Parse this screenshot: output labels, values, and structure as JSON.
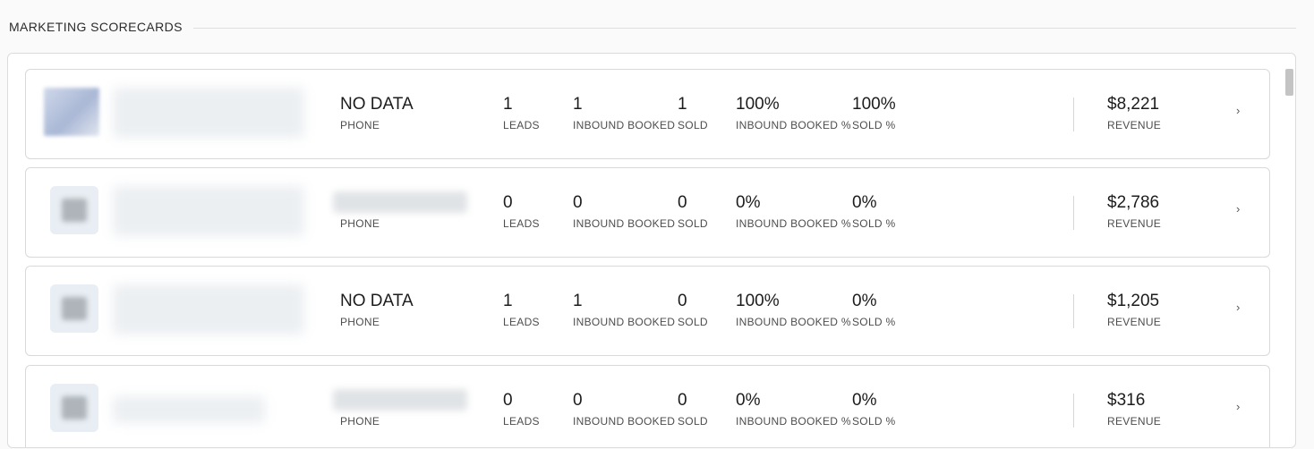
{
  "section": {
    "title": "MARKETING SCORECARDS"
  },
  "labels": {
    "phone": "PHONE",
    "leads": "LEADS",
    "inbound_booked": "INBOUND BOOKED",
    "sold": "SOLD",
    "inbound_booked_pct": "INBOUND BOOKED %",
    "sold_pct": "SOLD %",
    "revenue": "REVENUE"
  },
  "cards": [
    {
      "phone": "NO DATA",
      "leads": "1",
      "inbound_booked": "1",
      "sold": "1",
      "inbound_booked_pct": "100%",
      "sold_pct": "100%",
      "revenue": "$8,221"
    },
    {
      "phone": "",
      "leads": "0",
      "inbound_booked": "0",
      "sold": "0",
      "inbound_booked_pct": "0%",
      "sold_pct": "0%",
      "revenue": "$2,786"
    },
    {
      "phone": "NO DATA",
      "leads": "1",
      "inbound_booked": "1",
      "sold": "0",
      "inbound_booked_pct": "100%",
      "sold_pct": "0%",
      "revenue": "$1,205"
    },
    {
      "phone": "",
      "leads": "0",
      "inbound_booked": "0",
      "sold": "0",
      "inbound_booked_pct": "0%",
      "sold_pct": "0%",
      "revenue": "$316"
    }
  ],
  "icons": {
    "chevron": "chevron-right-icon"
  }
}
